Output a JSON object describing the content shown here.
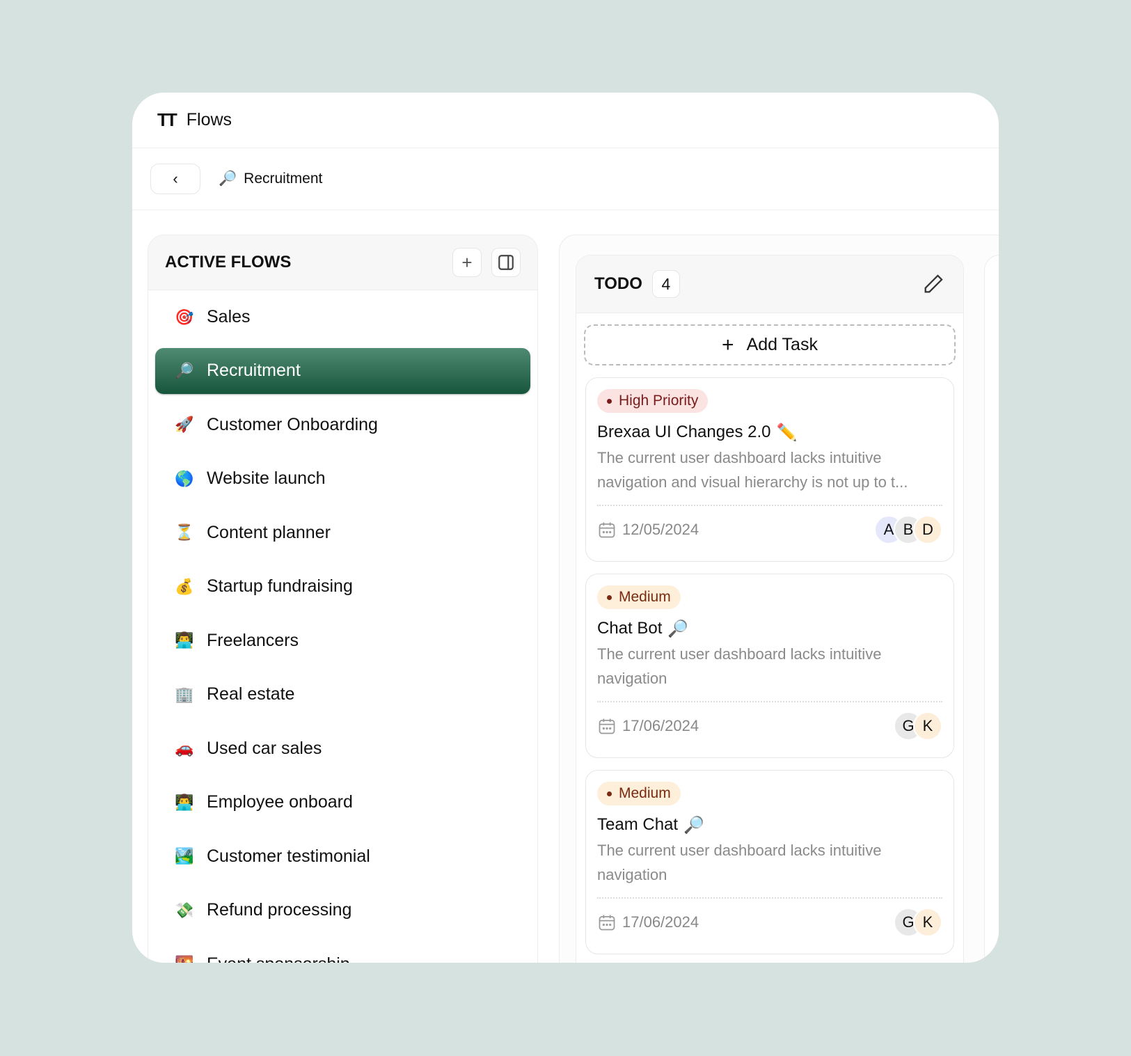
{
  "app": {
    "title": "Flows",
    "logo_icon": "flows-logo"
  },
  "breadcrumb": {
    "back_icon": "chevron-left",
    "emoji": "🔎",
    "label": "Recruitment"
  },
  "sidebar": {
    "title": "ACTIVE FLOWS",
    "items": [
      {
        "emoji": "🎯",
        "label": "Sales"
      },
      {
        "emoji": "🔎",
        "label": "Recruitment",
        "selected": true
      },
      {
        "emoji": "🚀",
        "label": "Customer Onboarding"
      },
      {
        "emoji": "🌎",
        "label": "Website launch"
      },
      {
        "emoji": "⏳",
        "label": "Content planner"
      },
      {
        "emoji": "💰",
        "label": "Startup fundraising"
      },
      {
        "emoji": "👨‍💻",
        "label": "Freelancers"
      },
      {
        "emoji": "🏢",
        "label": "Real estate"
      },
      {
        "emoji": "🚗",
        "label": "Used car sales"
      },
      {
        "emoji": "👨‍💻",
        "label": "Employee onboard"
      },
      {
        "emoji": "🏞️",
        "label": "Customer testimonial"
      },
      {
        "emoji": "💸",
        "label": "Refund processing"
      },
      {
        "emoji": "🌇",
        "label": "Event sponsorship"
      }
    ],
    "selected_color": "#1d5a41"
  },
  "column": {
    "title": "TODO",
    "count": "4",
    "add_label": "Add Task",
    "cards": [
      {
        "priority": "High Priority",
        "priority_bg": "#fbe3e2",
        "priority_fg": "#7a1b1b",
        "title": "Brexaa UI Changes 2.0",
        "emoji": "✏️",
        "desc": "The current user dashboard lacks intuitive navigation and visual hierarchy is not up to t...",
        "date": "12/05/2024",
        "avatars": [
          {
            "l": "A",
            "bg": "#e5e8fb"
          },
          {
            "l": "B",
            "bg": "#e8e8e8"
          },
          {
            "l": "D",
            "bg": "#fdeed9"
          }
        ]
      },
      {
        "priority": "Medium",
        "priority_bg": "#fdefd9",
        "priority_fg": "#7a2a10",
        "title": "Chat Bot",
        "emoji": "🔎",
        "desc": "The current user dashboard lacks intuitive navigation",
        "date": "17/06/2024",
        "avatars": [
          {
            "l": "G",
            "bg": "#e8e8e8"
          },
          {
            "l": "K",
            "bg": "#fdeed9"
          }
        ]
      },
      {
        "priority": "Medium",
        "priority_bg": "#fdefd9",
        "priority_fg": "#7a2a10",
        "title": "Team Chat",
        "emoji": "🔎",
        "desc": "The current user dashboard lacks intuitive navigation",
        "date": "17/06/2024",
        "avatars": [
          {
            "l": "G",
            "bg": "#e8e8e8"
          },
          {
            "l": "K",
            "bg": "#fdeed9"
          }
        ]
      }
    ]
  }
}
